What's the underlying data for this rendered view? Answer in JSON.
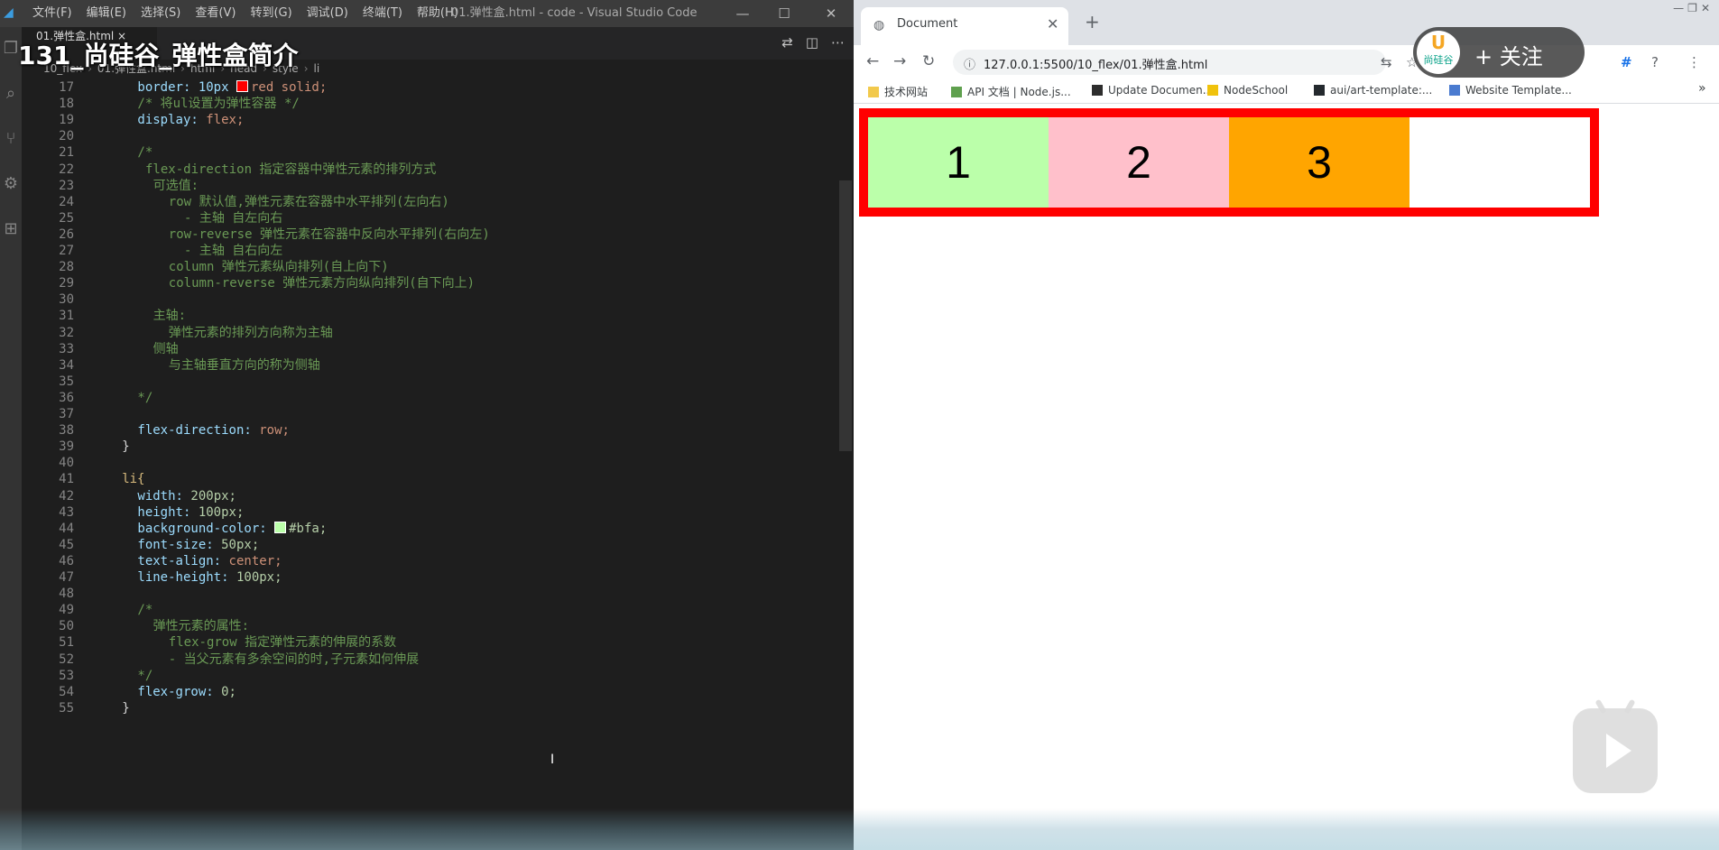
{
  "video": {
    "title": "131_尚硅谷_弹性盒简介"
  },
  "vscode": {
    "logo": "◢",
    "menu": [
      "文件(F)",
      "编辑(E)",
      "选择(S)",
      "查看(V)",
      "转到(G)",
      "调试(D)",
      "终端(T)",
      "帮助(H)"
    ],
    "window_title": "01.弹性盒.html - code - Visual Studio Code",
    "window_controls": {
      "minimize": "—",
      "maximize": "☐",
      "close": "✕"
    },
    "activity_icons": {
      "explorer": "❐",
      "search": "⌕",
      "source_control": "⑂",
      "debug": "⚙",
      "extensions": "⊞"
    },
    "tab": {
      "label": "01.弹性盒.html ×"
    },
    "tab_actions": {
      "compare": "⇄",
      "split": "◫",
      "more": "⋯"
    },
    "breadcrumb": [
      "10_flex",
      "01.弹性盒.html",
      "html",
      "head",
      "style",
      "li"
    ],
    "code_lines": [
      {
        "n": "17",
        "i": 4,
        "k": "prop",
        "t": "border: 10px ",
        "sw": "#ff0000",
        "v": "red solid;"
      },
      {
        "n": "18",
        "i": 4,
        "k": "com",
        "t": "/* 将ul设置为弹性容器 */"
      },
      {
        "n": "19",
        "i": 4,
        "k": "prop",
        "t": "display: ",
        "v": "flex;"
      },
      {
        "n": "20",
        "i": 0,
        "k": "plain",
        "t": ""
      },
      {
        "n": "21",
        "i": 4,
        "k": "com",
        "t": "/*"
      },
      {
        "n": "22",
        "i": 5,
        "k": "com",
        "t": "flex-direction 指定容器中弹性元素的排列方式"
      },
      {
        "n": "23",
        "i": 6,
        "k": "com",
        "t": "可选值:"
      },
      {
        "n": "24",
        "i": 8,
        "k": "com",
        "t": "row 默认值,弹性元素在容器中水平排列(左向右)"
      },
      {
        "n": "25",
        "i": 10,
        "k": "com",
        "t": "- 主轴 自左向右"
      },
      {
        "n": "26",
        "i": 8,
        "k": "com",
        "t": "row-reverse 弹性元素在容器中反向水平排列(右向左)"
      },
      {
        "n": "27",
        "i": 10,
        "k": "com",
        "t": "- 主轴 自右向左"
      },
      {
        "n": "28",
        "i": 8,
        "k": "com",
        "t": "column 弹性元素纵向排列(自上向下)"
      },
      {
        "n": "29",
        "i": 8,
        "k": "com",
        "t": "column-reverse 弹性元素方向纵向排列(自下向上)"
      },
      {
        "n": "30",
        "i": 0,
        "k": "plain",
        "t": ""
      },
      {
        "n": "31",
        "i": 6,
        "k": "com",
        "t": "主轴:"
      },
      {
        "n": "32",
        "i": 8,
        "k": "com",
        "t": "弹性元素的排列方向称为主轴"
      },
      {
        "n": "33",
        "i": 6,
        "k": "com",
        "t": "侧轴"
      },
      {
        "n": "34",
        "i": 8,
        "k": "com",
        "t": "与主轴垂直方向的称为侧轴"
      },
      {
        "n": "35",
        "i": 0,
        "k": "plain",
        "t": ""
      },
      {
        "n": "36",
        "i": 4,
        "k": "com",
        "t": "*/"
      },
      {
        "n": "37",
        "i": 0,
        "k": "plain",
        "t": ""
      },
      {
        "n": "38",
        "i": 4,
        "k": "prop",
        "t": "flex-direction: ",
        "v": "row;"
      },
      {
        "n": "39",
        "i": 2,
        "k": "plain",
        "t": "}"
      },
      {
        "n": "40",
        "i": 0,
        "k": "plain",
        "t": ""
      },
      {
        "n": "41",
        "i": 2,
        "k": "sel",
        "t": "li{"
      },
      {
        "n": "42",
        "i": 4,
        "k": "prop",
        "t": "width: ",
        "v": "200px;"
      },
      {
        "n": "43",
        "i": 4,
        "k": "prop",
        "t": "height: ",
        "v": "100px;"
      },
      {
        "n": "44",
        "i": 4,
        "k": "prop",
        "t": "background-color: ",
        "sw": "#bbffaa",
        "v": "#bfa;"
      },
      {
        "n": "45",
        "i": 4,
        "k": "prop",
        "t": "font-size: ",
        "v": "50px;"
      },
      {
        "n": "46",
        "i": 4,
        "k": "prop",
        "t": "text-align: ",
        "v": "center;"
      },
      {
        "n": "47",
        "i": 4,
        "k": "prop",
        "t": "line-height: ",
        "v": "100px;"
      },
      {
        "n": "48",
        "i": 0,
        "k": "plain",
        "t": ""
      },
      {
        "n": "49",
        "i": 4,
        "k": "com",
        "t": "/*"
      },
      {
        "n": "50",
        "i": 6,
        "k": "com",
        "t": "弹性元素的属性:"
      },
      {
        "n": "51",
        "i": 8,
        "k": "com",
        "t": "flex-grow 指定弹性元素的伸展的系数"
      },
      {
        "n": "52",
        "i": 8,
        "k": "com",
        "t": "- 当父元素有多余空间的时,子元素如何伸展"
      },
      {
        "n": "53",
        "i": 4,
        "k": "com",
        "t": "*/"
      },
      {
        "n": "54",
        "i": 4,
        "k": "prop",
        "t": "flex-grow: ",
        "v": "0;"
      },
      {
        "n": "55",
        "i": 2,
        "k": "plain",
        "t": "}"
      }
    ],
    "text_cursor": "I"
  },
  "browser": {
    "tab": {
      "icon": "◍",
      "title": "Document",
      "close": "✕"
    },
    "new_tab": "+",
    "window_controls": {
      "minimize": "—",
      "restore": "❐",
      "close": "✕"
    },
    "nav": {
      "back": "←",
      "forward": "→",
      "reload": "↻"
    },
    "omnibox": {
      "info": "ⓘ",
      "url": "127.0.0.1:5500/10_flex/01.弹性盒.html"
    },
    "toolbar_icons": {
      "translate": "⇆",
      "star": "☆",
      "puzzle": "#",
      "help": "?",
      "menu": "⋮"
    },
    "follow": {
      "logo_mark": "U",
      "logo_text": "尚硅谷",
      "label": "+ 关注"
    },
    "bookmarks": [
      {
        "label": "技术网站",
        "color": "#f2c94c"
      },
      {
        "label": "API 文档 | Node.js...",
        "color": "#5fa04e"
      },
      {
        "label": "Update Documen...",
        "color": "#2d2d2d"
      },
      {
        "label": "NodeSchool",
        "color": "#f0c20c"
      },
      {
        "label": "aui/art-template:...",
        "color": "#24292e"
      },
      {
        "label": "Website Template...",
        "color": "#4a7bd0"
      }
    ],
    "bookmarks_more": "»",
    "flex_items": [
      {
        "label": "1",
        "color": "#bbffaa"
      },
      {
        "label": "2",
        "color": "#ffc0cb"
      },
      {
        "label": "3",
        "color": "#ffa500"
      }
    ],
    "container_border_color": "#ff0000"
  }
}
